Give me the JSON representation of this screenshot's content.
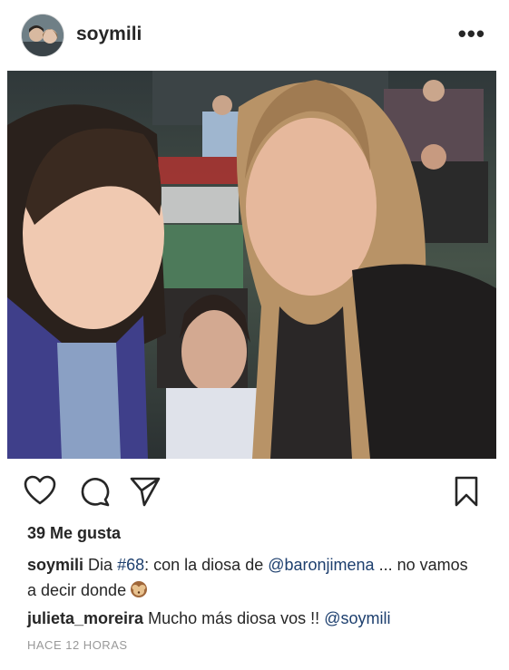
{
  "post": {
    "username": "soymili",
    "more_icon": "more-horizontal-icon"
  },
  "actions": {
    "like_icon": "heart-icon",
    "comment_icon": "comment-icon",
    "share_icon": "send-icon",
    "save_icon": "bookmark-icon"
  },
  "likes": "39 Me gusta",
  "caption": {
    "username": "soymili",
    "text_before": "Dia",
    "hashtag": "#68",
    "text_middle": ": con la diosa de",
    "mention": "@baronjimena",
    "text_after": "... no vamos a decir donde",
    "emoji": "see-no-evil-monkey-emoji"
  },
  "comment": {
    "username": "julieta_moreira",
    "text": "Mucho más diosa vos !!",
    "mention": "@soymili"
  },
  "timestamp": "HACE 12 HORAS",
  "colors": {
    "link": "#1d3f6e",
    "text": "#262626",
    "muted": "#999999"
  }
}
